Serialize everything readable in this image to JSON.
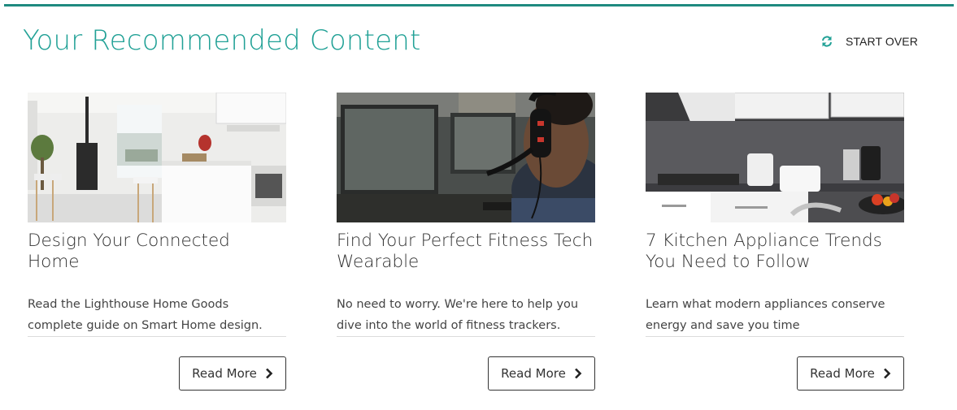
{
  "header": {
    "title": "Your Recommended Content",
    "start_over_label": "START OVER",
    "start_over_icon": "refresh-icon",
    "accent_color": "#21a196"
  },
  "cards": [
    {
      "title": "Design Your Connected Home",
      "description": "Read the Lighthouse Home Goods complete guide on Smart Home design.",
      "button_label": "Read More",
      "button_icon": "chevron-right-icon",
      "image": "modern-white-kitchen-photo"
    },
    {
      "title": "Find Your Perfect Fitness Tech Wearable",
      "description": "No need to worry. We're here to help you dive into the world of fitness trackers.",
      "button_label": "Read More",
      "button_icon": "chevron-right-icon",
      "image": "man-with-headset-at-computer-photo"
    },
    {
      "title": "7 Kitchen Appliance Trends You Need to Follow",
      "description": "Learn what modern appliances conserve energy and save you time",
      "button_label": "Read More",
      "button_icon": "chevron-right-icon",
      "image": "kitchen-countertop-appliances-photo"
    }
  ]
}
